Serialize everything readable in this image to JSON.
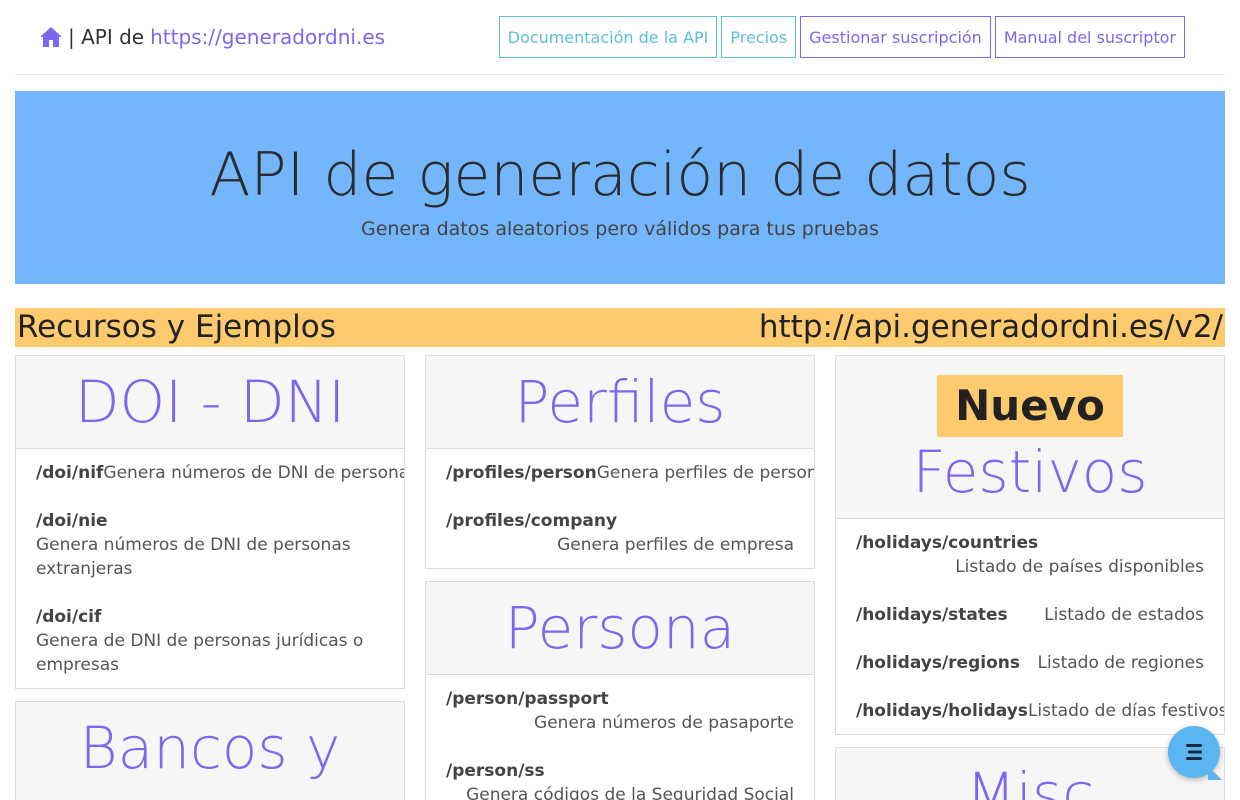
{
  "navbar": {
    "brand_text": "| API de",
    "brand_link": "https://generadordni.es",
    "home_icon": "home-icon",
    "buttons": [
      {
        "label": "Documentación de la API",
        "style": "info"
      },
      {
        "label": "Precios",
        "style": "info"
      },
      {
        "label": "Gestionar suscripción",
        "style": "primary"
      },
      {
        "label": "Manual del suscriptor",
        "style": "primary"
      }
    ]
  },
  "hero": {
    "title": "API de generación de datos",
    "subtitle": "Genera datos aleatorios pero válidos para tus pruebas"
  },
  "resources": {
    "title": "Recursos y Ejemplos",
    "base_url": "http://api.generadordni.es/v2/"
  },
  "cards": {
    "doi": {
      "title": "DOI - DNI",
      "endpoints": [
        {
          "path": "/doi/nif",
          "desc": "Genera números de DNI de personas"
        },
        {
          "path": "/doi/nie",
          "desc": "Genera números de DNI de personas extranjeras"
        },
        {
          "path": "/doi/cif",
          "desc": "Genera de DNI de personas jurídicas o empresas"
        }
      ]
    },
    "bancos": {
      "title": "Bancos y"
    },
    "perfiles": {
      "title": "Perfiles",
      "endpoints": [
        {
          "path": "/profiles/person",
          "desc": "Genera perfiles de persona"
        },
        {
          "path": "/profiles/company",
          "desc": "Genera perfiles de empresa"
        }
      ]
    },
    "persona": {
      "title": "Persona",
      "endpoints": [
        {
          "path": "/person/passport",
          "desc": "Genera números de pasaporte"
        },
        {
          "path": "/person/ss",
          "desc": "Genera códigos de la Seguridad Social"
        }
      ]
    },
    "festivos": {
      "badge": "Nuevo",
      "title": "Festivos",
      "endpoints": [
        {
          "path": "/holidays/countries",
          "desc": "Listado de países disponibles"
        },
        {
          "path": "/holidays/states",
          "desc": "Listado de estados"
        },
        {
          "path": "/holidays/regions",
          "desc": "Listado de regiones"
        },
        {
          "path": "/holidays/holidays",
          "desc": "Listado de días festivos"
        }
      ]
    },
    "misc": {
      "title": "Misc"
    }
  },
  "chat": {
    "icon": "chat-icon"
  },
  "colors": {
    "hero_bg": "#74b6fc",
    "accent_purple": "#7b68ee",
    "resource_bar": "#fdcb6e",
    "info_button": "#5bc0de"
  }
}
